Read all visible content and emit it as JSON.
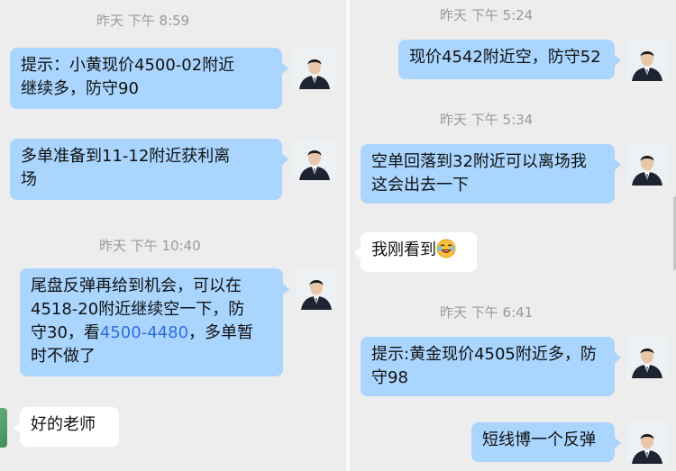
{
  "left": {
    "timestamps": [
      "昨天  下午 8:59",
      "昨天  下午 10:40"
    ],
    "messages": [
      {
        "line1": "提示：小黄现价4500-02附近",
        "line2": "继续多，防守90"
      },
      {
        "line1": "多单准备到11-12附近获利离",
        "line2": "场"
      },
      {
        "line1": "尾盘反弹再给到机会，可以在",
        "line2": "4518-20附近继续空一下，防",
        "line3_a": "守30，看",
        "line3_link": "4500-4480",
        "line3_b": "，多单暂",
        "line4": "时不做了"
      },
      {
        "text": "好的老师"
      }
    ]
  },
  "right": {
    "timestamps": [
      "昨天  下午 5:24",
      "昨天  下午 5:34",
      "昨天  下午 6:41"
    ],
    "messages": [
      {
        "text": "现价4542附近空，防守52"
      },
      {
        "line1": "空单回落到32附近可以离场我",
        "line2": "这会出去一下"
      },
      {
        "text": "我刚看到",
        "emoji": "laughing-face-icon"
      },
      {
        "line1": "提示:黄金现价4505附近多，防",
        "line2": "守98"
      },
      {
        "text": "短线博一个反弹"
      }
    ]
  }
}
